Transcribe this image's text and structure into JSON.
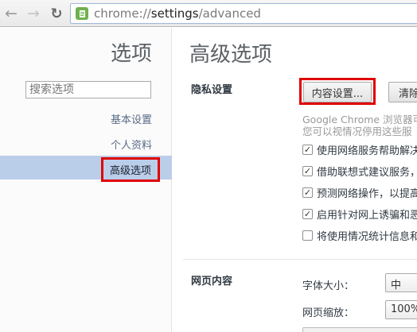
{
  "browser": {
    "back_icon": "arrow-left-icon",
    "forward_icon": "arrow-right-icon",
    "reload_icon": "reload-icon",
    "url_scheme": "chrome://",
    "url_host": "settings",
    "url_path": "/advanced",
    "page_icon_color": "#6fb04f"
  },
  "sidebar": {
    "title": "选项",
    "search_placeholder": "搜索选项",
    "items": [
      {
        "label": "基本设置"
      },
      {
        "label": "个人资料"
      },
      {
        "label": "高级选项",
        "selected": true
      }
    ],
    "highlight_color": "#e00000"
  },
  "main": {
    "title": "高级选项",
    "privacy": {
      "label": "隐私设置",
      "content_settings_button": "内容设置...",
      "clear_button": "清除",
      "description_line1": "Google Chrome 浏览器可",
      "description_line2": "您可以视情况停用这些服",
      "options": [
        {
          "label": "使用网络服务帮助解决",
          "checked": true
        },
        {
          "label": "借助联想式建议服务，",
          "checked": true
        },
        {
          "label": "预测网络操作，以提高",
          "checked": true
        },
        {
          "label": "启用针对网上诱骗和恶",
          "checked": true
        },
        {
          "label": "将使用情况统计信息和",
          "checked": false
        }
      ]
    },
    "web_content": {
      "label": "网页内容",
      "font_size_label": "字体大小：",
      "font_size_value": "中",
      "zoom_label": "网页缩放：",
      "zoom_value": "100%"
    }
  }
}
